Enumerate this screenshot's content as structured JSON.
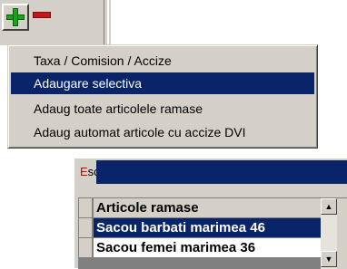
{
  "toolbar": {
    "add_icon": "plus-icon",
    "remove_icon": "minus-icon",
    "add_color": "#19a519",
    "remove_color": "#c4161c"
  },
  "menu": {
    "items": [
      {
        "label": "Taxa / Comision / Accize",
        "selected": false
      },
      {
        "label": "Adaugare selectiva",
        "selected": true
      },
      {
        "label": "Adaug toate articolele ramase",
        "selected": false
      },
      {
        "label": "Adaug automat articole cu accize DVI",
        "selected": false
      }
    ],
    "selected_color": "#0a246a"
  },
  "subwindow": {
    "esc_first_letter": "E",
    "esc_rest": "sc",
    "grid": {
      "header": "Articole ramase",
      "rows": [
        "Sacou barbati marimea 46",
        "Sacou femei marimea 36"
      ],
      "selected_row": 0
    }
  }
}
